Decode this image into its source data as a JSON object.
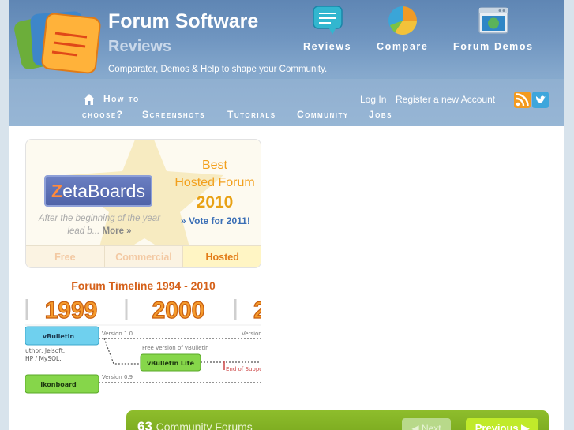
{
  "header": {
    "title": "Forum Software",
    "subtitle": "Reviews",
    "tagline": "Comparator, Demos & Help to shape your Community."
  },
  "topnav": [
    {
      "label": "Reviews",
      "icon": "chat-bubble-icon"
    },
    {
      "label": "Compare",
      "icon": "pie-chart-icon"
    },
    {
      "label": "Forum Demos",
      "icon": "browser-window-icon"
    }
  ],
  "nav": {
    "home_icon": "home-icon",
    "links": [
      "How to",
      "choose?",
      "Screenshots",
      "Tutorials",
      "Community",
      "Jobs"
    ],
    "login": "Log In",
    "register": "Register a new Account",
    "rss_icon": "rss-icon",
    "twitter_icon": "twitter-icon"
  },
  "promo": {
    "brand_prefix": "Z",
    "brand_rest": "etaBoards",
    "award_line1": "Best",
    "award_line2": "Hosted Forum",
    "award_year": "2010",
    "vote": "» Vote for 2011!",
    "description": "After the beginning of the year lead b...",
    "more": "More »",
    "tabs": [
      {
        "label": "Free",
        "active": false
      },
      {
        "label": "Commercial",
        "active": false
      },
      {
        "label": "Hosted",
        "active": true
      }
    ]
  },
  "timeline": {
    "title": "Forum Timeline 1994 - 2010",
    "years": [
      "1999",
      "2000",
      "2"
    ],
    "items": [
      {
        "name": "vBulletin",
        "note": "Version 1.0"
      },
      {
        "name": "vBulletin Lite",
        "note": "Free version of vBulletin"
      },
      {
        "name": "Ikonboard",
        "note": "Version 0.9"
      }
    ],
    "author_lines": [
      "uthor: Jelsoft.",
      "HP / MySQL."
    ],
    "version_cut": "Version",
    "end_support": "End of Suppo"
  },
  "bottom": {
    "count": "63",
    "label": "Community Forums",
    "next": "Next",
    "previous": "Previous"
  },
  "colors": {
    "header_blue": "#6f95c0",
    "accent_orange": "#f2a01e",
    "timeline_orange": "#d5611a",
    "green_bar": "#82b124",
    "link_blue": "#3b6fb6"
  }
}
